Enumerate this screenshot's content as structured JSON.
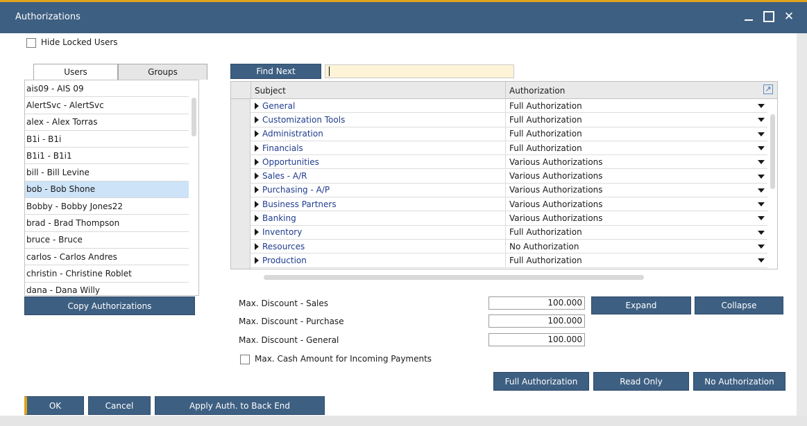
{
  "window": {
    "title": "Authorizations"
  },
  "hide_locked": {
    "label": "Hide Locked Users",
    "checked": false
  },
  "tabs": [
    {
      "label": "Users",
      "active": true
    },
    {
      "label": "Groups",
      "active": false
    }
  ],
  "users": [
    "ais09 - AIS 09",
    "AlertSvc - AlertSvc",
    "alex - Alex Torras",
    "B1i - B1i",
    "B1i1 - B1i1",
    "bill - Bill Levine",
    "bob - Bob Shone",
    "Bobby - Bobby Jones22",
    "brad - Brad Thompson",
    "bruce - Bruce",
    "carlos - Carlos Andres",
    "christin - Christine Roblet",
    "dana - Dana Willy"
  ],
  "selected_user": "bob - Bob Shone",
  "buttons": {
    "copy": "Copy Authorizations",
    "find_next": "Find Next",
    "expand": "Expand",
    "collapse": "Collapse",
    "full_auth": "Full Authorization",
    "read_only": "Read Only",
    "no_auth": "No Authorization",
    "ok": "OK",
    "cancel": "Cancel",
    "apply": "Apply Auth. to Back End"
  },
  "find": {
    "value": ""
  },
  "grid": {
    "headers": {
      "subject": "Subject",
      "authorization": "Authorization"
    },
    "rows": [
      {
        "subject": "General",
        "authorization": "Full Authorization"
      },
      {
        "subject": "Customization Tools",
        "authorization": "Full Authorization"
      },
      {
        "subject": "Administration",
        "authorization": "Full Authorization"
      },
      {
        "subject": "Financials",
        "authorization": "Full Authorization"
      },
      {
        "subject": "Opportunities",
        "authorization": "Various Authorizations"
      },
      {
        "subject": "Sales - A/R",
        "authorization": "Various Authorizations"
      },
      {
        "subject": "Purchasing - A/P",
        "authorization": "Various Authorizations"
      },
      {
        "subject": "Business Partners",
        "authorization": "Various Authorizations"
      },
      {
        "subject": "Banking",
        "authorization": "Various Authorizations"
      },
      {
        "subject": "Inventory",
        "authorization": "Full Authorization"
      },
      {
        "subject": "Resources",
        "authorization": "No Authorization"
      },
      {
        "subject": "Production",
        "authorization": "Full Authorization"
      }
    ]
  },
  "discounts": {
    "sales": {
      "label": "Max. Discount - Sales",
      "value": "100.000"
    },
    "purchase": {
      "label": "Max. Discount - Purchase",
      "value": "100.000"
    },
    "general": {
      "label": "Max. Discount - General",
      "value": "100.000"
    }
  },
  "cash": {
    "label": "Max. Cash Amount for Incoming Payments",
    "checked": false
  },
  "colors": {
    "titlebar": "#3d5f82",
    "button": "#3d5f82",
    "accent": "#e1a21c",
    "selection": "#cde3f7",
    "find_field": "#fdf3d7",
    "link_text": "#1f3c8e"
  }
}
